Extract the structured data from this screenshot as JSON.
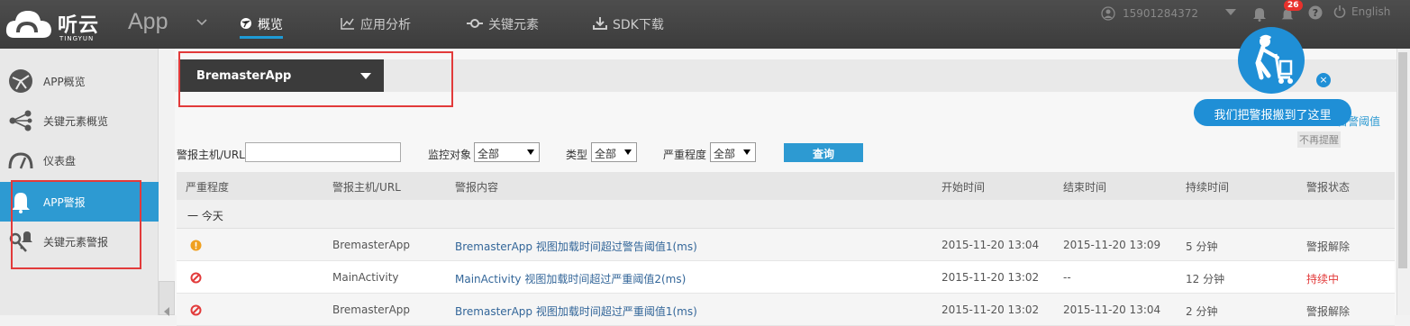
{
  "brand": {
    "name": "听云",
    "sub": "TINGYUN",
    "app_title": "App"
  },
  "nav": [
    {
      "label": "概览",
      "icon": "globe-icon",
      "active": true
    },
    {
      "label": "应用分析",
      "icon": "chart-icon"
    },
    {
      "label": "关键元素",
      "icon": "node-icon"
    },
    {
      "label": "SDK下载",
      "icon": "download-icon"
    }
  ],
  "header": {
    "user": "15901284372",
    "badge": "26",
    "lang": "English"
  },
  "sidebar": {
    "items": [
      {
        "label": "APP概览",
        "icon": "globe-icon"
      },
      {
        "label": "关键元素概览",
        "icon": "share-icon"
      },
      {
        "label": "仪表盘",
        "icon": "gauge-icon"
      },
      {
        "label": "APP警报",
        "icon": "bell-icon",
        "active": true
      },
      {
        "label": "关键元素警报",
        "icon": "key-bell-icon"
      }
    ]
  },
  "app_selector": {
    "value": "BremasterApp"
  },
  "filters": {
    "host_label": "警报主机/URL",
    "target_label": "监控对象",
    "target_value": "全部",
    "type_label": "类型",
    "type_value": "全部",
    "severity_label": "严重程度",
    "severity_value": "全部",
    "query_label": "查询"
  },
  "table": {
    "headers": [
      "严重程度",
      "警报主机/URL",
      "警报内容",
      "开始时间",
      "结束时间",
      "持续时间",
      "警报状态"
    ],
    "group": "一  今天",
    "rows": [
      {
        "severity": "warning",
        "host": "BremasterApp",
        "content": "BremasterApp 视图加载时间超过警告阈值1(ms)",
        "start": "2015-11-20 13:04",
        "end": "2015-11-20 13:09",
        "duration": "5 分钟",
        "status": "警报解除"
      },
      {
        "severity": "critical",
        "host": "MainActivity",
        "content": "MainActivity 视图加载时间超过严重阈值2(ms)",
        "start": "2015-11-20 13:02",
        "end": "--",
        "duration": "12 分钟",
        "status": "持续中"
      },
      {
        "severity": "critical",
        "host": "BremasterApp",
        "content": "BremasterApp 视图加载时间超过严重阈值1(ms)",
        "start": "2015-11-20 13:02",
        "end": "2015-11-20 13:04",
        "duration": "2 分钟",
        "status": "警报解除"
      }
    ]
  },
  "right_link": "告警阈值",
  "no_remind": "不再提醒",
  "promo": {
    "text": "我们把警报搬到了这里",
    "close": "×"
  },
  "colors": {
    "accent": "#2d9ad2",
    "critical": "#e23a3a",
    "warning": "#f0a020",
    "ongoing": "#e23a3a"
  }
}
